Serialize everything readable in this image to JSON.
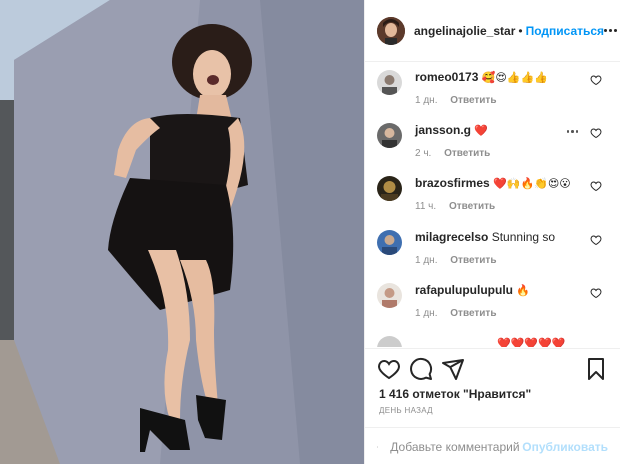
{
  "post": {
    "image_alt": "Photo of woman in black dress laughing against a concrete wall",
    "author": {
      "username": "angelinajolie_star",
      "separator": "•",
      "follow_label": "Подписаться"
    },
    "comments": [
      {
        "username": "romeo0173",
        "text": "🥰😍👍👍👍",
        "time": "1 дн.",
        "reply": "Ответить"
      },
      {
        "username": "jansson.g",
        "text": "❤️",
        "time": "2 ч.",
        "reply": "Ответить"
      },
      {
        "username": "brazosfirmes",
        "text": "❤️🙌🔥👏😍😮",
        "time": "11 ч.",
        "reply": "Ответить"
      },
      {
        "username": "milagrecelso",
        "text": "Stunning so",
        "time": "1 дн.",
        "reply": "Ответить"
      },
      {
        "username": "rafapulupulupulu",
        "text": "🔥",
        "time": "1 дн.",
        "reply": "Ответить"
      },
      {
        "username": "",
        "text": "❤️❤️❤️❤️❤️",
        "time": "",
        "reply": ""
      }
    ],
    "likes": "1 416 отметок \"Нравится\"",
    "posted": "ДЕНЬ НАЗАД",
    "add_comment": {
      "placeholder": "Добавьте комментарий...",
      "publish_label": "Опубликовать"
    },
    "colors": {
      "link": "#0095f6",
      "publish_disabled": "#b2dffc",
      "meta": "#8e8e8e"
    }
  }
}
